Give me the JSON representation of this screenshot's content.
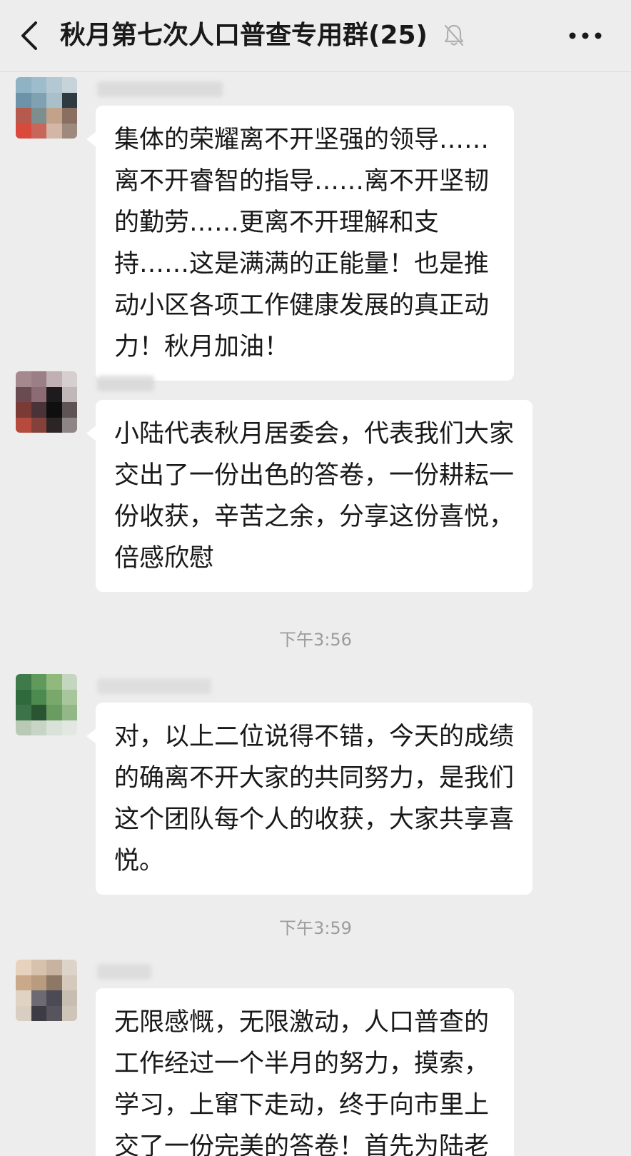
{
  "header": {
    "title": "秋月第七次人口普查专用群(25)",
    "back_icon": "chevron-left-icon",
    "mute_icon": "bell-muted-icon",
    "more_icon": "more-dots-icon"
  },
  "messages": [
    {
      "sender_hint": "…鹏",
      "text": "集体的荣耀离不开坚强的领导……离不开睿智的指导……离不开坚韧的勤劳……更离不开理解和支持……这是满满的正能量！也是推动小区各项工作健康发展的真正动力！秋月加油！"
    },
    {
      "sender_hint": "…明",
      "text": "小陆代表秋月居委会，代表我们大家交出了一份出色的答卷，一份耕耘一份收获，辛苦之余，分享这份喜悦，倍感欣慰"
    },
    {
      "time": "下午3:56",
      "sender_hint": "",
      "text": "对，以上二位说得不错，今天的成绩的确离不开大家的共同努力，是我们这个团队每个人的收获，大家共享喜悦。"
    },
    {
      "time": "下午3:59",
      "sender_hint": "…宝珍",
      "text": "无限感慨，无限激动，人口普查的工作经过一个半月的努力，摸索，学习，上窜下走动，终于向市里上交了一份完美的答卷！首先为陆老"
    }
  ],
  "colors": {
    "background": "#ededed",
    "bubble": "#ffffff",
    "text": "#191919",
    "timestamp": "#9c9c9c"
  }
}
